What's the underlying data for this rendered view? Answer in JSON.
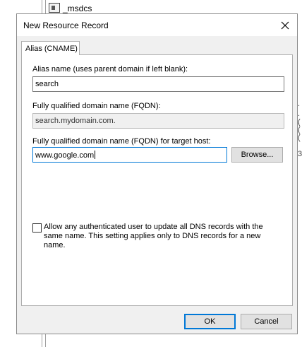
{
  "background": {
    "zone_item": "_msdcs",
    "edge_fragments": [
      ".",
      ".(",
      ".(",
      ".(",
      "3."
    ]
  },
  "dialog": {
    "title": "New Resource Record",
    "close_icon": "close-icon",
    "tab_label": "Alias (CNAME)",
    "alias_label": "Alias name (uses parent domain if left blank):",
    "alias_value": "search",
    "fqdn_label": "Fully qualified domain name (FQDN):",
    "fqdn_value": "search.mydomain.com.",
    "target_label": "Fully qualified domain name (FQDN) for target host:",
    "target_value": "www.google.com",
    "browse_label": "Browse...",
    "checkbox_label": "Allow any authenticated user to update all DNS records with the same name. This setting applies only to DNS records for a new name.",
    "checkbox_checked": false,
    "ok_label": "OK",
    "cancel_label": "Cancel",
    "accent_color": "#0078d7"
  }
}
